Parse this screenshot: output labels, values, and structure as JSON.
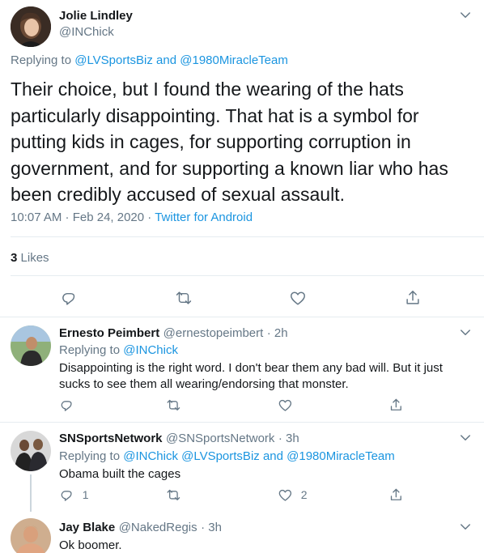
{
  "main_tweet": {
    "author_name": "Jolie Lindley",
    "author_handle": "@INChick",
    "replying_prefix": "Replying to",
    "replying_user1": "@LVSportsBiz",
    "replying_and": "and",
    "replying_user2": "@1980MiracleTeam",
    "text": "Their choice, but I found the wearing of the hats particularly disappointing. That hat is a symbol for putting kids in cages, for supporting corruption in government, and for supporting a known liar who has been credibly accused of sexual assault.",
    "time_date": "10:07 AM · Feb 24, 2020 ·",
    "source": "Twitter for Android",
    "likes_count": "3",
    "likes_label": "Likes"
  },
  "replies": [
    {
      "author_name": "Ernesto Peimbert",
      "author_handle": "@ernestopeimbert",
      "age": "· 2h",
      "replying_prefix": "Replying to",
      "replying_users": "@INChick",
      "text": "Disappointing is the right word. I don't bear them any bad will. But it just sucks to see them all wearing/endorsing that monster.",
      "reply_count": "",
      "like_count": ""
    },
    {
      "author_name": "SNSportsNetwork",
      "author_handle": "@SNSportsNetwork",
      "age": "· 3h",
      "replying_prefix": "Replying to",
      "replying_users": "@INChick @LVSportsBiz and @1980MiracleTeam",
      "text": "Obama built the cages",
      "reply_count": "1",
      "like_count": "2"
    },
    {
      "author_name": "Jay Blake",
      "author_handle": "@NakedRegis",
      "age": "· 3h",
      "text": "Ok boomer."
    }
  ],
  "icons": {
    "reply": "reply-icon",
    "retweet": "retweet-icon",
    "like": "heart-icon",
    "share": "share-icon",
    "more": "chevron-down-icon"
  },
  "colors": {
    "link": "#1b95e0",
    "muted": "#657786",
    "text": "#14171a",
    "divider": "#e6ecf0"
  }
}
